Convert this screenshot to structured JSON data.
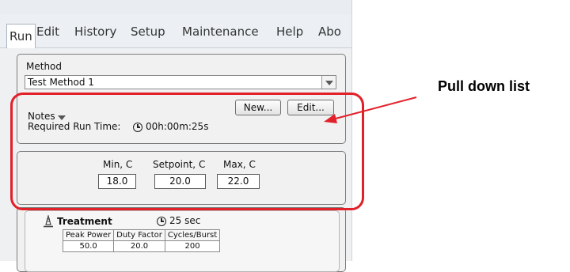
{
  "menu": {
    "items": [
      "Run",
      "Edit",
      "History",
      "Setup",
      "Maintenance",
      "Help",
      "Abo"
    ]
  },
  "method": {
    "label": "Method",
    "selected": "Test Method 1"
  },
  "buttons": {
    "new": "New...",
    "edit": "Edit..."
  },
  "notes": {
    "label": "Notes",
    "run_time_label": "Required Run Time:",
    "run_time_value": "00h:00m:25s"
  },
  "temperature": {
    "min_label": "Min, C",
    "setpoint_label": "Setpoint, C",
    "max_label": "Max, C",
    "min_value": "18.0",
    "setpoint_value": "20.0",
    "max_value": "22.0"
  },
  "treatment": {
    "title": "Treatment",
    "duration": "25 sec",
    "columns": [
      "Peak Power",
      "Duty Factor",
      "Cycles/Burst"
    ],
    "values": [
      "50.0",
      "20.0",
      "200"
    ]
  },
  "annotation": {
    "callout_text": "Pull down list",
    "highlight_color": "#e2202a"
  }
}
